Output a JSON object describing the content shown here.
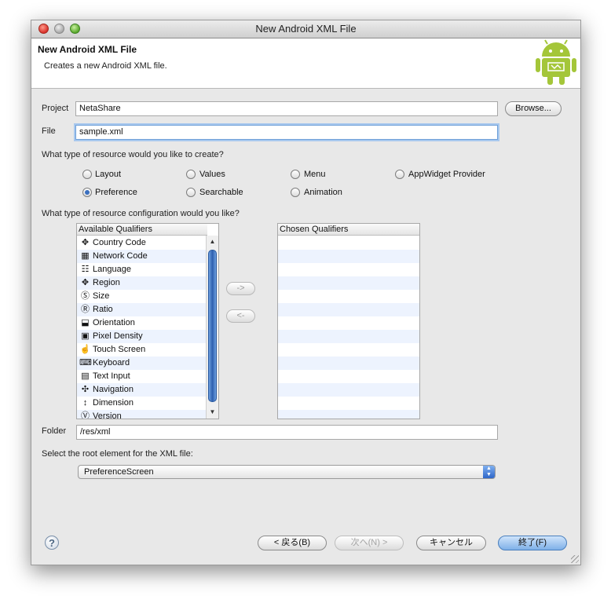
{
  "window": {
    "title": "New Android XML File"
  },
  "header": {
    "title": "New Android XML File",
    "description": "Creates a new Android XML file."
  },
  "project": {
    "label": "Project",
    "value": "NetaShare",
    "browse_label": "Browse..."
  },
  "file": {
    "label": "File",
    "value": "sample.xml"
  },
  "resource_type": {
    "question": "What type of resource would you like to create?",
    "options": [
      "Layout",
      "Values",
      "Menu",
      "AppWidget Provider",
      "Preference",
      "Searchable",
      "Animation"
    ],
    "selected": "Preference"
  },
  "config": {
    "question": "What type of resource configuration would you like?",
    "available_header": "Available Qualifiers",
    "chosen_header": "Chosen Qualifiers",
    "add_label": "->",
    "remove_label": "<-",
    "qualifiers": [
      {
        "label": "Country Code",
        "icon": "country-code-icon"
      },
      {
        "label": "Network Code",
        "icon": "network-code-icon"
      },
      {
        "label": "Language",
        "icon": "language-icon"
      },
      {
        "label": "Region",
        "icon": "region-icon"
      },
      {
        "label": "Size",
        "icon": "size-icon"
      },
      {
        "label": "Ratio",
        "icon": "ratio-icon"
      },
      {
        "label": "Orientation",
        "icon": "orientation-icon"
      },
      {
        "label": "Pixel Density",
        "icon": "pixel-density-icon"
      },
      {
        "label": "Touch Screen",
        "icon": "touch-screen-icon"
      },
      {
        "label": "Keyboard",
        "icon": "keyboard-icon"
      },
      {
        "label": "Text Input",
        "icon": "text-input-icon"
      },
      {
        "label": "Navigation",
        "icon": "navigation-icon"
      },
      {
        "label": "Dimension",
        "icon": "dimension-icon"
      },
      {
        "label": "Version",
        "icon": "version-icon"
      }
    ]
  },
  "folder": {
    "label": "Folder",
    "value": "/res/xml"
  },
  "root_element": {
    "label": "Select the root element for the XML file:",
    "value": "PreferenceScreen"
  },
  "footer": {
    "back_label": "< 戻る(B)",
    "next_label": "次へ(N) >",
    "cancel_label": "キャンセル",
    "finish_label": "終了(F)"
  },
  "colors": {
    "accent": "#3a6fbf",
    "android_green": "#a4c639",
    "selected_row": "#edf3fe"
  }
}
